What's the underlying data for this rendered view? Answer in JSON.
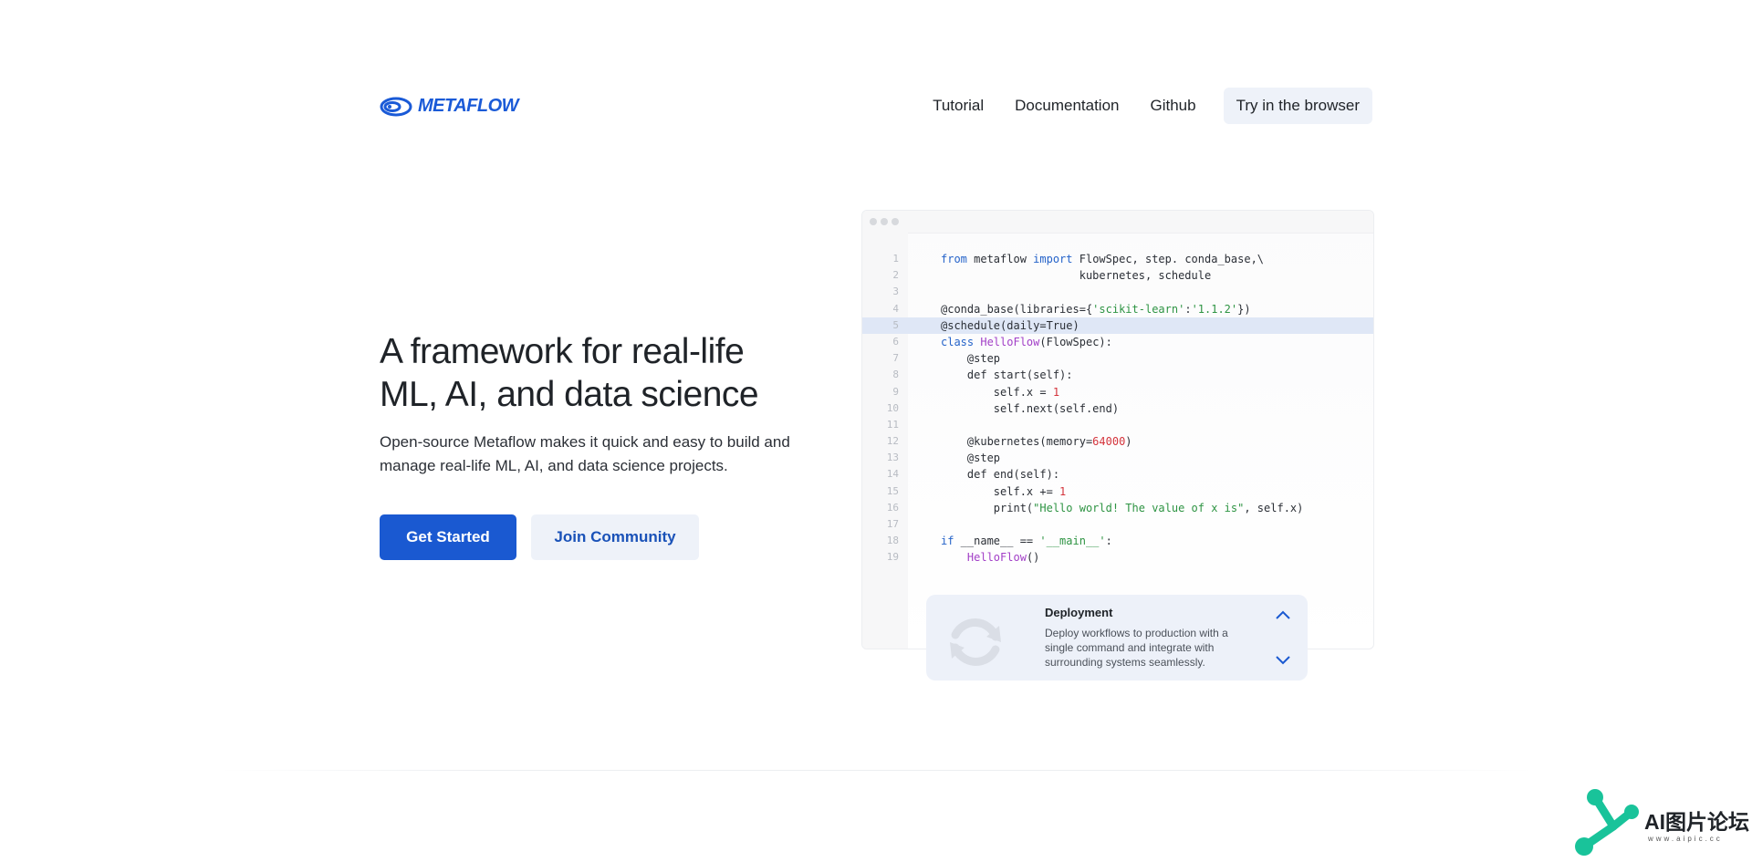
{
  "brand": {
    "name": "METAFLOW",
    "color": "#1a5ad7"
  },
  "nav": {
    "tutorial": "Tutorial",
    "documentation": "Documentation",
    "github": "Github",
    "try": "Try in the browser"
  },
  "hero": {
    "title": "A framework for real-life ML, AI, and data science",
    "subtitle": "Open-source Metaflow makes it quick and easy to build and manage real-life ML, AI, and data science projects.",
    "primary_button": "Get Started",
    "secondary_button": "Join Community"
  },
  "code": {
    "highlighted_line": 5,
    "line_numbers": [
      "1",
      "2",
      "3",
      "4",
      "5",
      "6",
      "7",
      "8",
      "9",
      "10",
      "11",
      "12",
      "13",
      "14",
      "15",
      "16",
      "17",
      "18",
      "19"
    ],
    "lines": [
      "from metaflow import FlowSpec, step. conda_base,\\",
      "                     kubernetes, schedule",
      "",
      "@conda_base(libraries={'scikit-learn':'1.1.2'})",
      "@schedule(daily=True)",
      "class HelloFlow(FlowSpec):",
      "    @step",
      "    def start(self):",
      "        self.x = 1",
      "        self.next(self.end)",
      "",
      "    @kubernetes(memory=64000)",
      "    @step",
      "    def end(self):",
      "        self.x += 1",
      "        print(\"Hello world! The value of x is\", self.x)",
      "",
      "if __name__ == '__main__':",
      "    HelloFlow()"
    ]
  },
  "feature_card": {
    "title": "Deployment",
    "description": "Deploy workflows to production with a single command and integrate with surrounding systems seamlessly.",
    "icon": "refresh-icon"
  },
  "watermark": {
    "text": "AI图片论坛",
    "sub": "www.aipic.cc"
  },
  "colors": {
    "accent": "#1a59d1",
    "secondary_bg": "#eef2f9",
    "keyword": "#2563c9",
    "string": "#2e9443",
    "number": "#d4343c",
    "class": "#a23fc7",
    "watermark": "#19c39a"
  }
}
